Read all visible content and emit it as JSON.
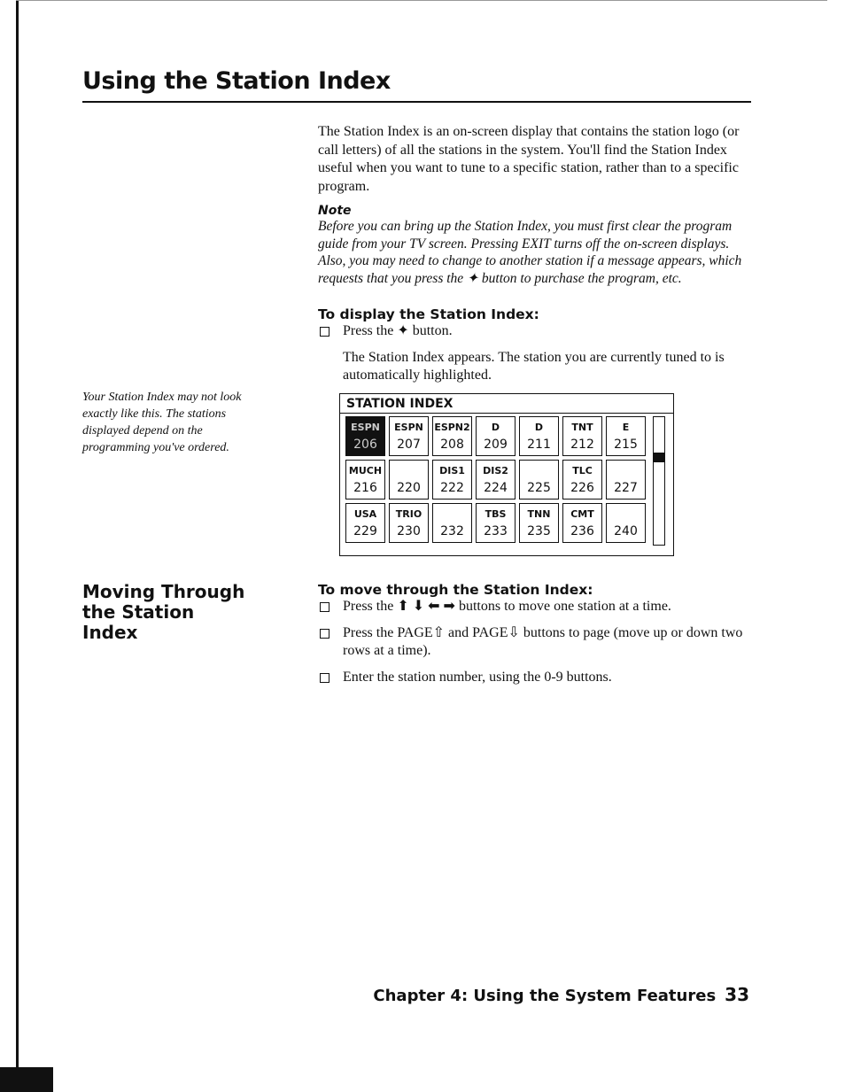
{
  "title": "Using the Station Index",
  "intro": "The Station Index is an on-screen display that contains the station logo (or call letters) of all the stations in the system. You'll find the Station Index useful when you want to tune to a specific station, rather than to a specific program.",
  "note": {
    "heading": "Note",
    "text": "Before you can bring up the Station Index, you must first clear the program guide from your TV screen. Pressing EXIT turns off the on-screen displays. Also, you may need to change to another station if a message appears, which requests that you press the ✦ button to purchase the program, etc."
  },
  "display": {
    "heading": "To display the Station Index:",
    "step": "Press the ✦ button.",
    "result": "The Station Index appears. The station you are currently tuned to is automatically highlighted."
  },
  "caption": "Your Station Index may not look exactly like this. The stations displayed depend on the programming you've ordered.",
  "station_index": {
    "header": "STATION INDEX",
    "selected": "206",
    "scroll_position": 0.3,
    "rows": [
      [
        {
          "logo": "ESPN",
          "num": "206"
        },
        {
          "logo": "ESPN",
          "num": "207"
        },
        {
          "logo": "ESPN2",
          "num": "208"
        },
        {
          "logo": "D",
          "num": "209"
        },
        {
          "logo": "D",
          "num": "211"
        },
        {
          "logo": "TNT",
          "num": "212"
        },
        {
          "logo": "E",
          "num": "215"
        }
      ],
      [
        {
          "logo": "MUCH",
          "num": "216"
        },
        {
          "logo": "",
          "num": "220"
        },
        {
          "logo": "DIS1",
          "num": "222"
        },
        {
          "logo": "DIS2",
          "num": "224"
        },
        {
          "logo": "",
          "num": "225"
        },
        {
          "logo": "TLC",
          "num": "226"
        },
        {
          "logo": "",
          "num": "227"
        }
      ],
      [
        {
          "logo": "USA",
          "num": "229"
        },
        {
          "logo": "TRIO",
          "num": "230"
        },
        {
          "logo": "",
          "num": "232"
        },
        {
          "logo": "TBS",
          "num": "233"
        },
        {
          "logo": "TNN",
          "num": "235"
        },
        {
          "logo": "CMT",
          "num": "236"
        },
        {
          "logo": "",
          "num": "240"
        }
      ]
    ]
  },
  "moving": {
    "side_heading": "Moving Through the Station Index",
    "heading": "To move through the Station Index:",
    "steps": [
      "Press the ⬆ ⬇ ⬅ ➡ buttons to move one station at a time.",
      "Press the PAGE⇧ and PAGE⇩ buttons to page (move up or down two rows at a time).",
      "Enter the station number, using the 0-9 buttons."
    ]
  },
  "footer": {
    "chapter": "Chapter 4: Using the System Features",
    "page": "33"
  }
}
